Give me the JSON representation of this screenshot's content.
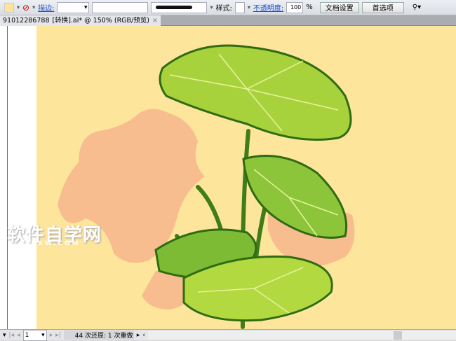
{
  "toolbar": {
    "stroke_label": "描边:",
    "style_label": "样式:",
    "opacity_label": "不透明度:",
    "opacity_value": "100",
    "opacity_unit": "%",
    "doc_setup": "文档设置",
    "preferences": "首选项",
    "fill_color": "#fde49a"
  },
  "tab": {
    "prefix": "91012286788",
    "title": "[转换].ai* @ 150% (RGB/预览)",
    "close": "×"
  },
  "status": {
    "page": "1",
    "history": "44 次还原: 1 次重做"
  },
  "watermark": {
    "cn": "软件自学网",
    "en": "RJZXW.COM"
  }
}
